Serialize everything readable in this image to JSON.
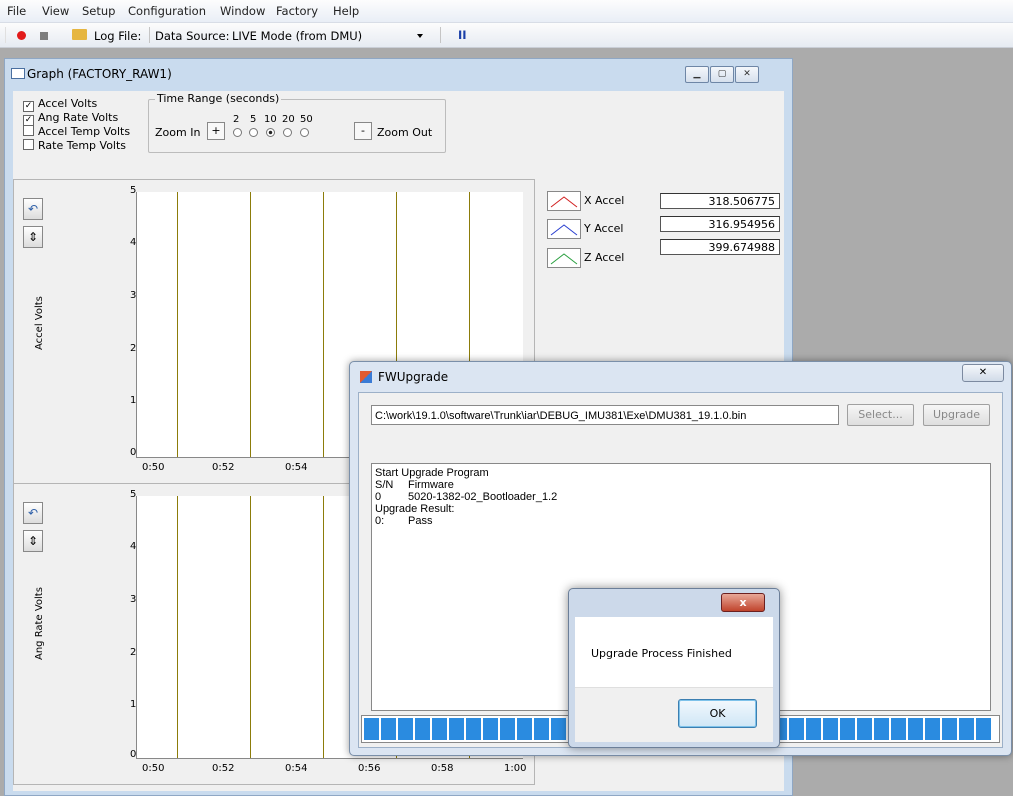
{
  "menubar": {
    "items": [
      "File",
      "View",
      "Setup",
      "Configuration",
      "Window",
      "Factory",
      "Help"
    ]
  },
  "toolbar": {
    "log_file_label": "Log File:",
    "data_source_label": "Data Source:",
    "data_source_value": "LIVE Mode (from DMU)",
    "pause_symbol": "II"
  },
  "graph_window": {
    "title": "Graph (FACTORY_RAW1)",
    "checkboxes": [
      {
        "label": "Accel Volts",
        "checked": true
      },
      {
        "label": "Ang Rate Volts",
        "checked": true
      },
      {
        "label": "Accel Temp Volts",
        "checked": false
      },
      {
        "label": "Rate Temp Volts",
        "checked": false
      }
    ],
    "time_range": {
      "legend": "Time Range (seconds)",
      "zoom_in": "Zoom In",
      "zoom_out": "Zoom Out",
      "plus": "+",
      "minus": "-",
      "options": [
        "2",
        "5",
        "10",
        "20",
        "50"
      ],
      "selected": "10"
    },
    "plot1": {
      "ylabel": "Accel Volts",
      "yticks": [
        "5",
        "4",
        "3",
        "2",
        "1",
        "0"
      ],
      "xticks": [
        "0:50",
        "0:52",
        "0:54"
      ]
    },
    "plot2": {
      "ylabel": "Ang Rate Volts",
      "yticks": [
        "5",
        "4",
        "3",
        "2",
        "1",
        "0"
      ],
      "xticks": [
        "0:50",
        "0:52",
        "0:54",
        "0:56",
        "0:58",
        "1:00"
      ]
    },
    "legend": [
      {
        "name": "X Accel",
        "color": "#d22020",
        "value": "318.506775"
      },
      {
        "name": "Y Accel",
        "color": "#2a3fd0",
        "value": "316.954956"
      },
      {
        "name": "Z Accel",
        "color": "#2aa040",
        "value": "399.674988"
      }
    ]
  },
  "fw_dialog": {
    "title": "FWUpgrade",
    "path": "C:\\work\\19.1.0\\software\\Trunk\\iar\\DEBUG_IMU381\\Exe\\DMU381_19.1.0.bin",
    "select_label": "Select...",
    "upgrade_label": "Upgrade",
    "log": {
      "start": "Start Upgrade Program",
      "sn": "S/N",
      "firmware": "Firmware",
      "row_index": "0",
      "row_fw": "5020-1382-02_Bootloader_1.2",
      "result_header": "Upgrade Result:",
      "result_index": "0:",
      "result_value": "Pass"
    },
    "progress": 1.0
  },
  "message_box": {
    "message": "Upgrade Process Finished",
    "ok_label": "OK",
    "close_symbol": "x"
  }
}
